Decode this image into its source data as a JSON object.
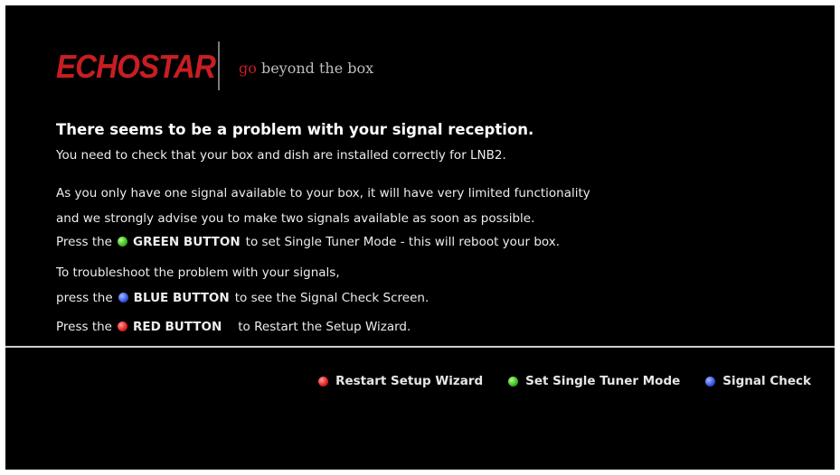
{
  "branding": {
    "logo_text": "ECHOSTAR",
    "tagline_prefix": "go",
    "tagline_rest": " beyond the box"
  },
  "message": {
    "heading": "There seems to be a problem with your signal reception.",
    "line1": "You need to check that your box and dish are installed correctly for LNB2.",
    "line2": "As you only have one signal available to your box, it will have very limited functionality",
    "line3": "and we strongly advise you to make two signals available as soon as possible.",
    "green_pre": "Press the",
    "green_button": "GREEN BUTTON",
    "green_post": "to set Single Tuner Mode - this will reboot your box.",
    "troubleshoot": "To troubleshoot the problem with your signals,",
    "blue_pre": "press the",
    "blue_button": "BLUE BUTTON",
    "blue_post": "to see the Signal Check Screen.",
    "red_pre": "Press the",
    "red_button": "RED BUTTON",
    "red_post": "to Restart the Setup Wizard."
  },
  "footer": {
    "red_label": "Restart Setup Wizard",
    "green_label": "Set Single Tuner Mode",
    "blue_label": "Signal Check"
  },
  "colors": {
    "brand_red": "#c81e22",
    "red_button": "#e01e1e",
    "green_button": "#38b81e",
    "blue_button": "#3553e0"
  }
}
